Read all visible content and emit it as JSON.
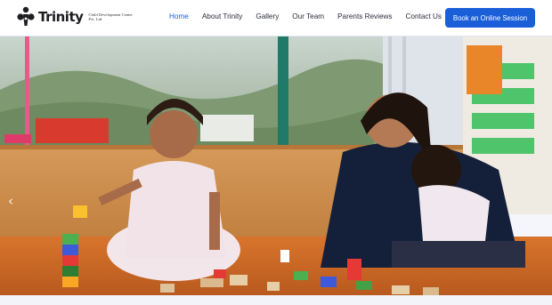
{
  "brand": {
    "name": "Trinity",
    "tagline": "Child Development Center Pvt. Ltd.",
    "primary_color": "#1a5fd8"
  },
  "nav": {
    "items": [
      {
        "label": "Home",
        "active": true
      },
      {
        "label": "About Trinity",
        "active": false
      },
      {
        "label": "Gallery",
        "active": false
      },
      {
        "label": "Our Team",
        "active": false
      },
      {
        "label": "Parents Reviews",
        "active": false
      },
      {
        "label": "Contact Us",
        "active": false
      }
    ]
  },
  "cta": {
    "label": "Book an Online Session"
  },
  "hero": {
    "prev_icon": "chevron-left-icon",
    "prev_glyph": "‹"
  }
}
